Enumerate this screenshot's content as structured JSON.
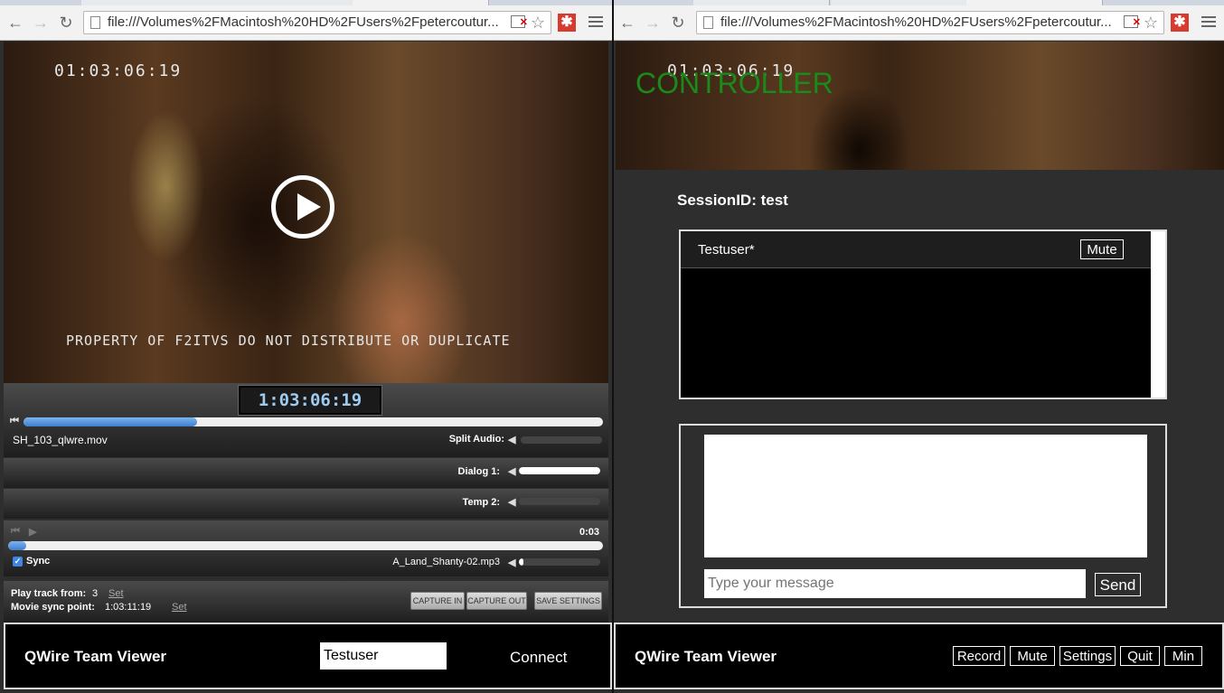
{
  "left_window": {
    "address": "file:///Volumes%2FMacintosh%20HD%2FUsers%2Fpetercoutur...",
    "video": {
      "burned_timecode": "01:03:06:19",
      "watermark": "PROPERTY OF F2ITVS DO NOT DISTRIBUTE OR DUPLICATE"
    },
    "player": {
      "timecode": "1:03:06:19",
      "progress": 0.3,
      "filename": "SH_103_qlwre.mov",
      "split_audio_label": "Split Audio:",
      "split_audio_level": 0,
      "dialog_label": "Dialog 1:",
      "dialog_level": 1.0,
      "temp_label": "Temp 2:",
      "temp_level": 0,
      "track_time": "0:03",
      "track_progress": 0.03,
      "sync_label": "Sync",
      "track_file": "A_Land_Shanty-02.mp3",
      "track_level": 0.05,
      "play_from_label": "Play track from:",
      "play_from_value": "3",
      "set_label": "Set",
      "sync_point_label": "Movie sync point:",
      "sync_point_value": "1:03:11:19",
      "capture_in": "CAPTURE IN",
      "capture_out": "CAPTURE OUT",
      "save_settings": "SAVE SETTINGS"
    },
    "footer": {
      "brand": "QWire Team Viewer",
      "username": "Testuser",
      "connect": "Connect"
    }
  },
  "right_window": {
    "address": "file:///Volumes%2FMacintosh%20HD%2FUsers%2Fpetercoutur...",
    "video": {
      "burned_timecode": "01:03:06:19",
      "overlay": "CONTROLLER"
    },
    "session": "SessionID: test",
    "users": [
      {
        "name": "Testuser*",
        "mute": "Mute"
      }
    ],
    "chat": {
      "placeholder": "Type your message",
      "send": "Send"
    },
    "footer": {
      "brand": "QWire Team Viewer",
      "buttons": [
        "Record",
        "Mute",
        "Settings",
        "Quit",
        "Min"
      ]
    }
  },
  "colors": {
    "controller_green": "#1a8a1a",
    "progress_blue": "#3d7fd0",
    "timecode_blue": "#9ecbf0"
  }
}
